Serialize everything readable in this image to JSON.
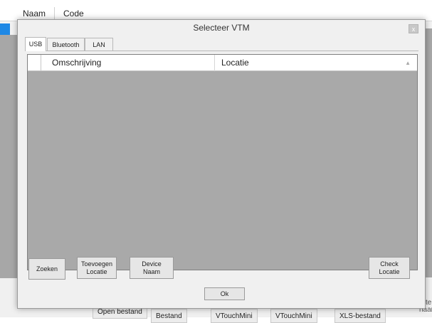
{
  "background": {
    "columns": [
      "Naam",
      "Code"
    ],
    "bottom_buttons": [
      "Open bestand",
      "Bestand",
      "VTouchMini",
      "VTouchMini",
      "XLS-bestand"
    ],
    "right_edge_texts": [
      "te",
      "naar"
    ]
  },
  "dialog": {
    "title": "Selecteer VTM",
    "close_label": "x",
    "tabs": [
      {
        "label": "USB",
        "active": true
      },
      {
        "label": "Bluetooth",
        "active": false
      },
      {
        "label": "LAN",
        "active": false
      }
    ],
    "list": {
      "columns": [
        "Omschrijving",
        "Locatie"
      ],
      "sort_icon": "▲"
    },
    "buttons": {
      "search": "Zoeken",
      "add_location_line1": "Toevoegen",
      "add_location_line2": "Locatie",
      "device_name_line1": "Device",
      "device_name_line2": "Naam",
      "check_location_line1": "Check",
      "check_location_line2": "Locatie",
      "ok": "Ok"
    }
  },
  "colors": {
    "dialog_bg": "#f0f0f0",
    "list_bg": "#a9a9a9",
    "selection_blue": "#1e88e5"
  }
}
